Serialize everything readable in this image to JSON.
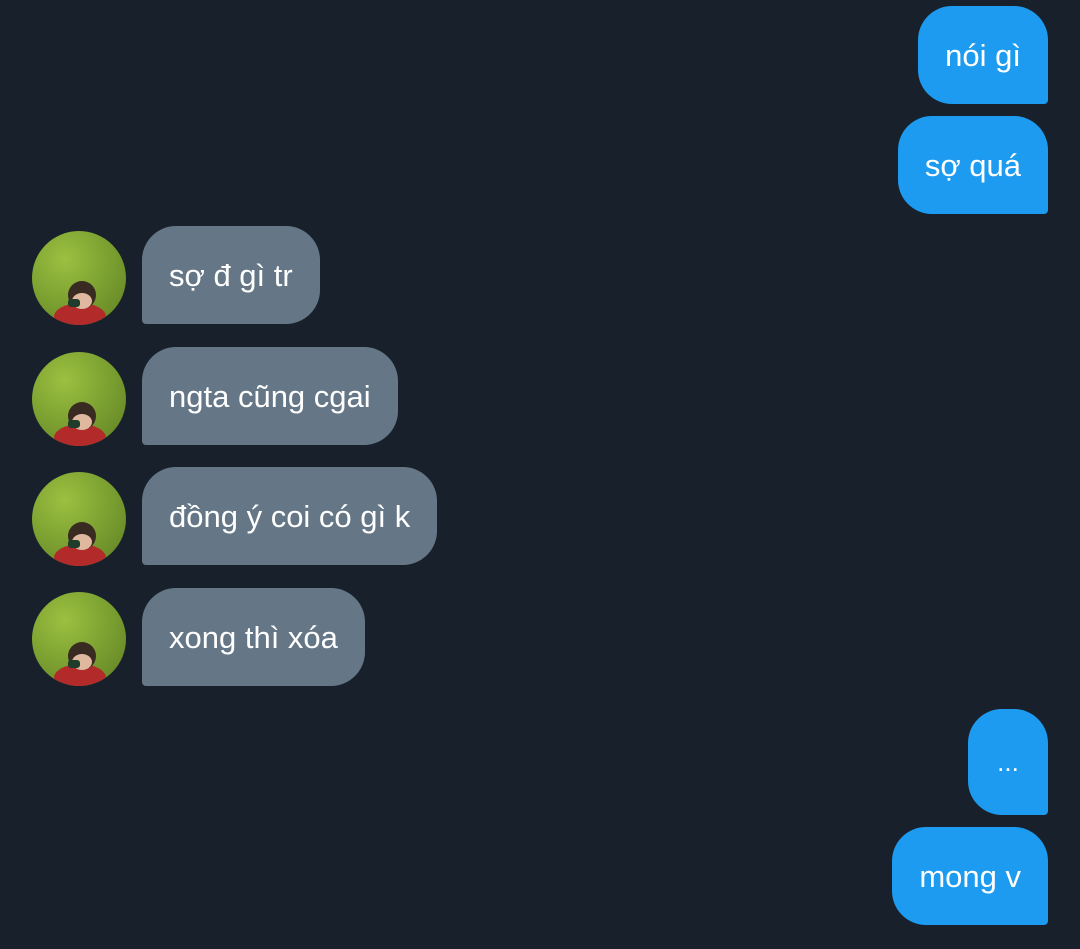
{
  "conversation": {
    "messages": [
      {
        "sender": "me",
        "text": "nói gì"
      },
      {
        "sender": "me",
        "text": "sợ quá"
      },
      {
        "sender": "them",
        "text": "sợ đ gì tr",
        "avatar_icon": "user-avatar-icon"
      },
      {
        "sender": "them",
        "text": "ngta cũng cgai",
        "avatar_icon": "user-avatar-icon"
      },
      {
        "sender": "them",
        "text": "đồng ý coi có gì k",
        "avatar_icon": "user-avatar-icon"
      },
      {
        "sender": "them",
        "text": "xong thì xóa",
        "avatar_icon": "user-avatar-icon"
      },
      {
        "sender": "me",
        "text": "..."
      },
      {
        "sender": "me",
        "text": "mong v"
      }
    ]
  },
  "colors": {
    "background": "#17202b",
    "sent_bubble": "#1d9bf0",
    "received_bubble": "#657786",
    "text": "#ffffff"
  }
}
